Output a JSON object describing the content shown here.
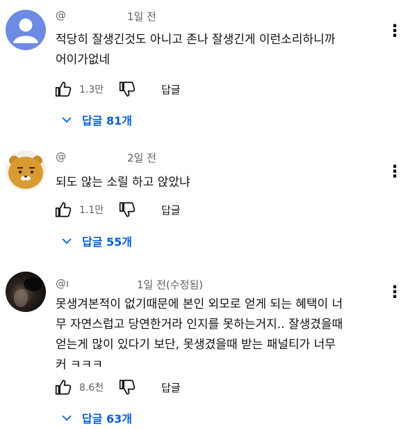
{
  "comments": [
    {
      "author": "@",
      "time": "1일 전",
      "text_lines": [
        "적당히 잘생긴것도 아니고 존나 잘생긴게 이런소리하니까",
        "어이가없네"
      ],
      "likes": "1.3만",
      "reply_label": "답글",
      "replies_label": "답글 81개",
      "avatar": "default-avatar-icon"
    },
    {
      "author": "@",
      "time": "2일 전",
      "text_lines": [
        "되도 않는  소릴 하고 앉았냐"
      ],
      "likes": "1.1만",
      "reply_label": "답글",
      "replies_label": "답글 55개",
      "avatar": "ryan-character-avatar"
    },
    {
      "author": "@ı",
      "time": "1일 전(수정됨)",
      "text_lines": [
        "못생겨본적이 없기때문에 본인 외모로 얻게 되는 혜택이 너",
        "무 자연스럽고 당연한거라 인지를 못하는거지.. 잘생겼을때",
        "얻는게 많이 있다기 보단, 못생겼을때 받는 패널티가 너무",
        "커 ㅋㅋㅋ"
      ],
      "likes": "8.6천",
      "reply_label": "답글",
      "replies_label": "답글 63개",
      "avatar": "dark-photo-avatar"
    }
  ],
  "icons": {
    "like": "thumbs-up-icon",
    "dislike": "thumbs-down-icon",
    "more": "more-vertical-icon",
    "expand": "chevron-down-icon"
  },
  "colors": {
    "link_blue": "#065fd4",
    "meta_gray": "#606060",
    "default_avatar_bg": "#6e8be3"
  }
}
